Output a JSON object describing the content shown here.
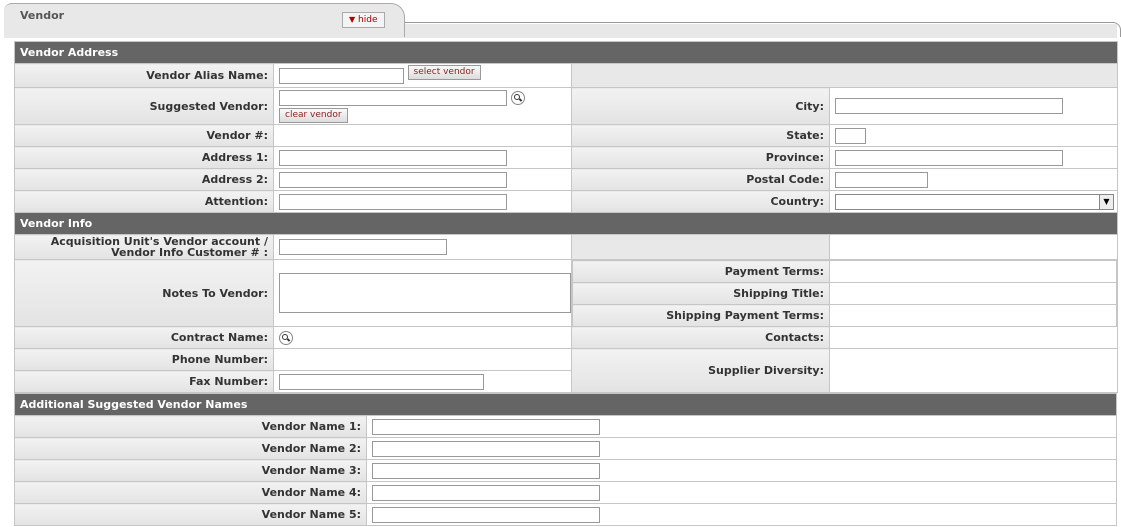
{
  "tab": {
    "title": "Vendor",
    "hide_label": "hide"
  },
  "vendor_address": {
    "section_title": "Vendor Address",
    "vendor_alias_name_label": "Vendor Alias Name:",
    "select_vendor_label": "select vendor",
    "suggested_vendor_label": "Suggested Vendor:",
    "clear_vendor_label": "clear vendor",
    "vendor_number_label": "Vendor #:",
    "address1_label": "Address 1:",
    "address2_label": "Address 2:",
    "attention_label": "Attention:",
    "city_label": "City:",
    "state_label": "State:",
    "province_label": "Province:",
    "postal_code_label": "Postal Code:",
    "country_label": "Country:"
  },
  "vendor_info": {
    "section_title": "Vendor Info",
    "account_label": "Acquisition Unit's Vendor account / Vendor Info Customer # :",
    "notes_label": "Notes To Vendor:",
    "contract_name_label": "Contract Name:",
    "phone_number_label": "Phone Number:",
    "fax_number_label": "Fax Number:",
    "payment_terms_label": "Payment Terms:",
    "shipping_title_label": "Shipping Title:",
    "shipping_payment_terms_label": "Shipping Payment Terms:",
    "contacts_label": "Contacts:",
    "supplier_diversity_label": "Supplier Diversity:"
  },
  "additional_names": {
    "section_title": "Additional Suggested Vendor Names",
    "labels": [
      "Vendor Name 1:",
      "Vendor Name 2:",
      "Vendor Name 3:",
      "Vendor Name 4:",
      "Vendor Name 5:"
    ]
  }
}
